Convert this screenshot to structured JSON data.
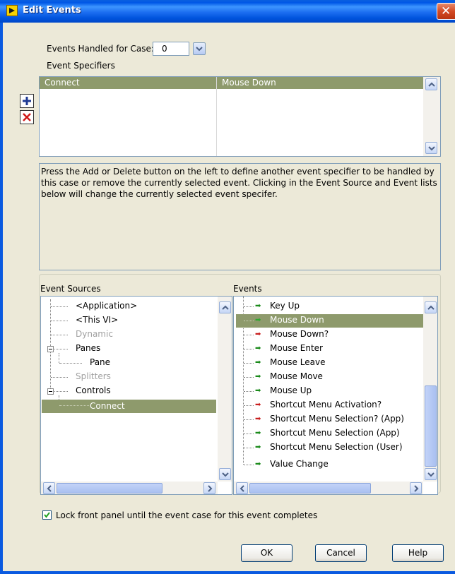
{
  "window": {
    "title": "Edit Events"
  },
  "handled_case": {
    "label": "Events Handled for Case:",
    "value": "0"
  },
  "specifiers": {
    "label": "Event Specifiers",
    "col_source": "Connect",
    "col_event": "Mouse Down"
  },
  "description": "Press the Add or Delete button on the left to define another event specifier to be handled by this case or remove the currently selected event. Clicking in the Event Source and Event lists below will change the currently selected event specifer.",
  "sources": {
    "label": "Event Sources",
    "items": [
      {
        "label": "<Application>"
      },
      {
        "label": "<This VI>"
      },
      {
        "label": "Dynamic"
      },
      {
        "label": "Panes"
      },
      {
        "label": "Pane"
      },
      {
        "label": "Splitters"
      },
      {
        "label": "Controls"
      },
      {
        "label": "Connect"
      }
    ]
  },
  "events": {
    "label": "Events",
    "items": [
      {
        "label": "Key Up",
        "arrow": "green"
      },
      {
        "label": "Mouse Down",
        "arrow": "green"
      },
      {
        "label": "Mouse Down?",
        "arrow": "red"
      },
      {
        "label": "Mouse Enter",
        "arrow": "green"
      },
      {
        "label": "Mouse Leave",
        "arrow": "green"
      },
      {
        "label": "Mouse Move",
        "arrow": "green"
      },
      {
        "label": "Mouse Up",
        "arrow": "green"
      },
      {
        "label": "Shortcut Menu Activation?",
        "arrow": "red"
      },
      {
        "label": "Shortcut Menu Selection? (App)",
        "arrow": "red"
      },
      {
        "label": "Shortcut Menu Selection (App)",
        "arrow": "green"
      },
      {
        "label": "Shortcut Menu Selection (User)",
        "arrow": "green"
      },
      {
        "label": "Value Change",
        "arrow": "green"
      }
    ]
  },
  "lock_option": {
    "label": "Lock front panel until the event case for this event completes",
    "checked": true
  },
  "buttons": {
    "ok": "OK",
    "cancel": "Cancel",
    "help": "Help"
  },
  "colors": {
    "selection": "#8e9a6c",
    "arrow_green": "#1a8a1a",
    "arrow_red": "#c81e1e",
    "accent": "#0a5ae0"
  }
}
